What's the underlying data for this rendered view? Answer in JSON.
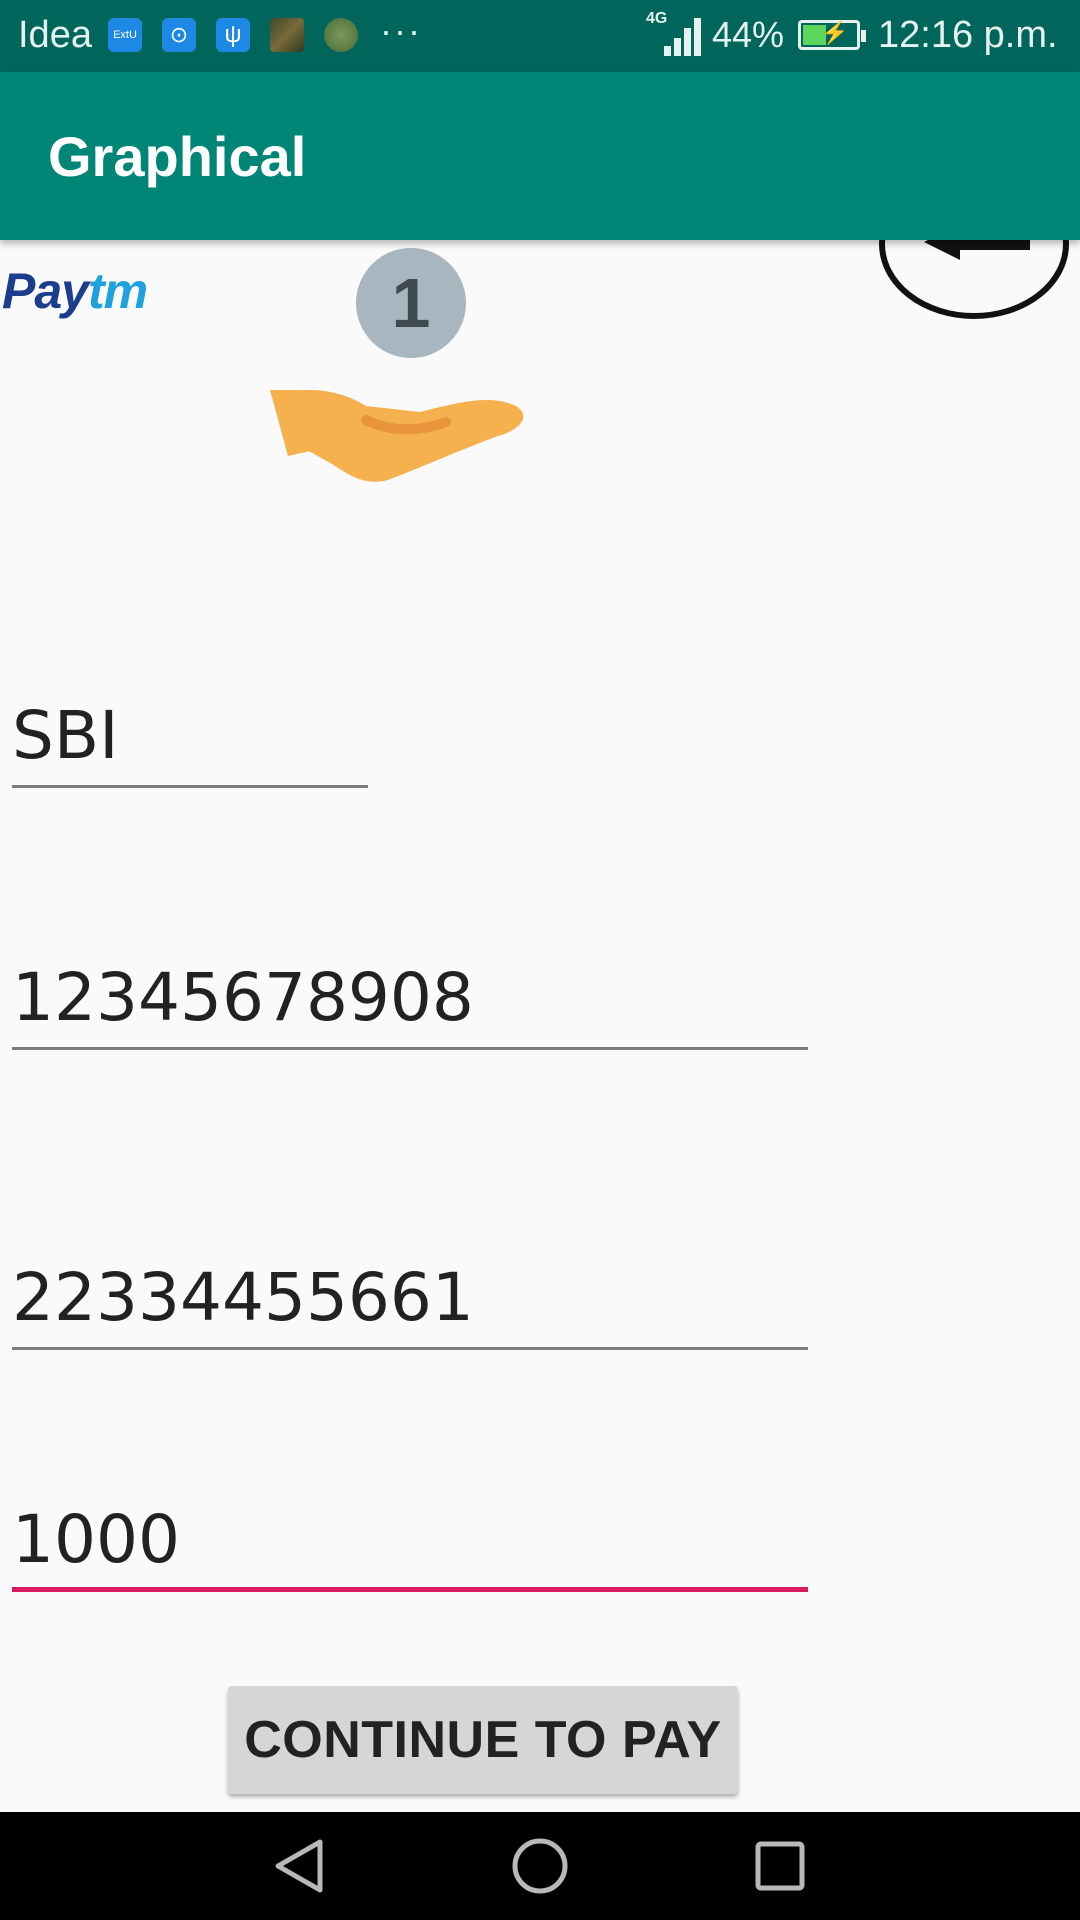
{
  "status_bar": {
    "carrier": "Idea",
    "notification_icons": [
      "extu-app-icon",
      "link-app-icon",
      "usb-icon",
      "photo-thumbnail-icon",
      "photo-thumbnail-icon"
    ],
    "more": "···",
    "network_type": "4G",
    "battery_percent": "44%",
    "battery_level": 0.44,
    "time": "12:16 p.m."
  },
  "app_bar": {
    "title": "Graphical"
  },
  "header": {
    "logo": {
      "pay": "Pay",
      "tm": "tm"
    },
    "step_number": "1",
    "illustration_icon": "hand-icon",
    "back_icon": "back-arrow-icon"
  },
  "form": {
    "bank_name": "SBI",
    "account_number": "12345678908",
    "second_number": "22334455661",
    "amount": "1000"
  },
  "actions": {
    "continue_label": "CONTINUE TO PAY"
  },
  "nav_bar": {
    "icons": [
      "back-nav-icon",
      "home-nav-icon",
      "recents-nav-icon"
    ]
  },
  "colors": {
    "status_bar": "#00665b",
    "app_bar": "#008577",
    "accent_underline": "#d81b60",
    "background": "#fafafa"
  }
}
